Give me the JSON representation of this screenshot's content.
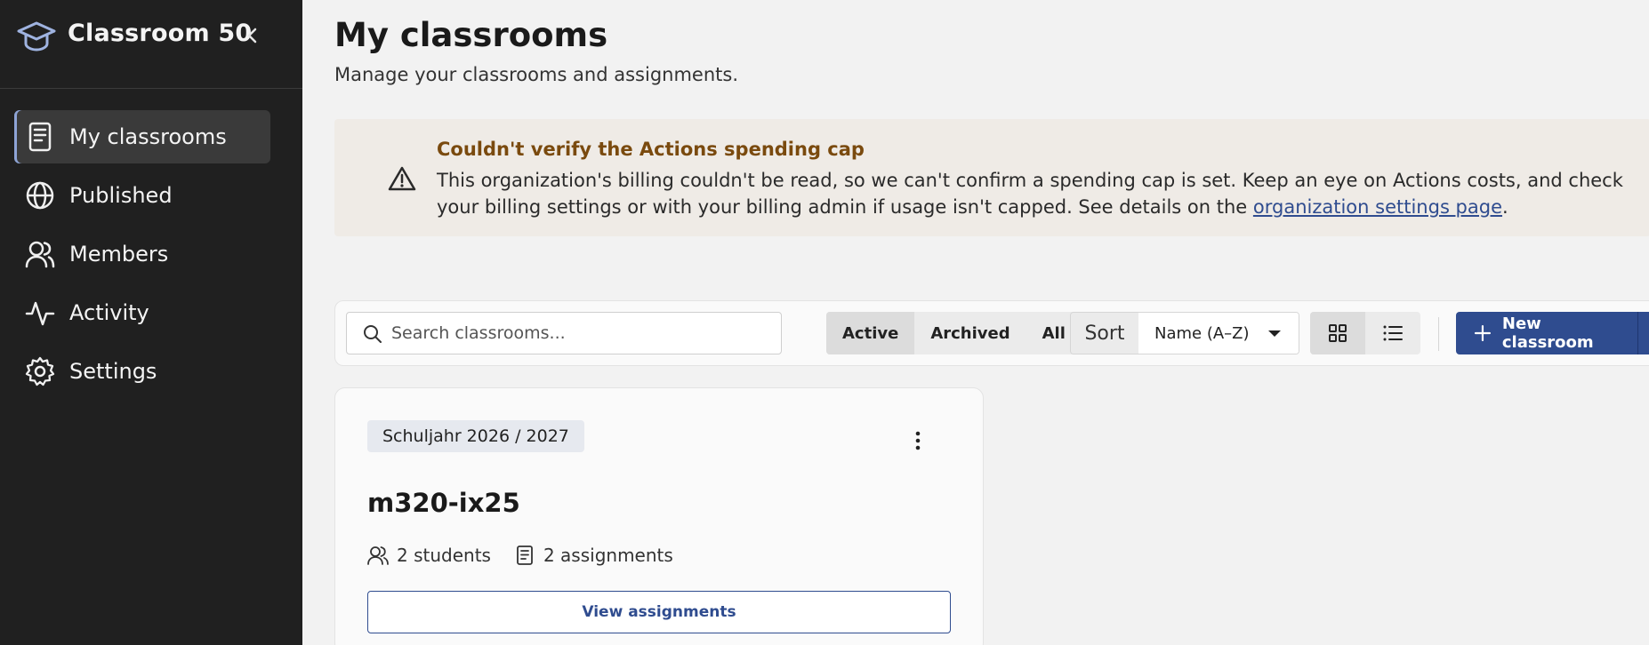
{
  "sidebar": {
    "brand": "Classroom 50",
    "items": [
      {
        "label": "My classrooms",
        "icon": "book-icon",
        "active": true
      },
      {
        "label": "Published",
        "icon": "globe-icon",
        "active": false
      },
      {
        "label": "Members",
        "icon": "users-icon",
        "active": false
      },
      {
        "label": "Activity",
        "icon": "activity-icon",
        "active": false
      },
      {
        "label": "Settings",
        "icon": "gear-icon",
        "active": false
      }
    ]
  },
  "header": {
    "title": "My classrooms",
    "subtitle": "Manage your classrooms and assignments."
  },
  "alert": {
    "title": "Couldn't verify the Actions spending cap",
    "body": "This organization's billing couldn't be read, so we can't confirm a spending cap is set. Keep an eye on Actions costs, and check your billing settings or with your billing admin if usage isn't capped. See details on the",
    "link": "organization settings page",
    "tail": "."
  },
  "toolbar": {
    "search_placeholder": "Search classrooms...",
    "filters": [
      "Active",
      "Archived",
      "All"
    ],
    "active_filter": "Active",
    "sort_label": "Sort",
    "sort_value": "Name (A–Z)",
    "view_active": "grid",
    "new_label": "New classroom"
  },
  "classrooms": [
    {
      "term": "Schuljahr 2026 / 2027",
      "name": "m320-ix25",
      "students": "2 students",
      "assignments": "2 assignments",
      "action": "View assignments"
    }
  ],
  "colors": {
    "sidebar_bg": "#202020",
    "accent": "#2f4c8f",
    "alert_bg": "#efebe6",
    "alert_title": "#7a4a0e"
  }
}
